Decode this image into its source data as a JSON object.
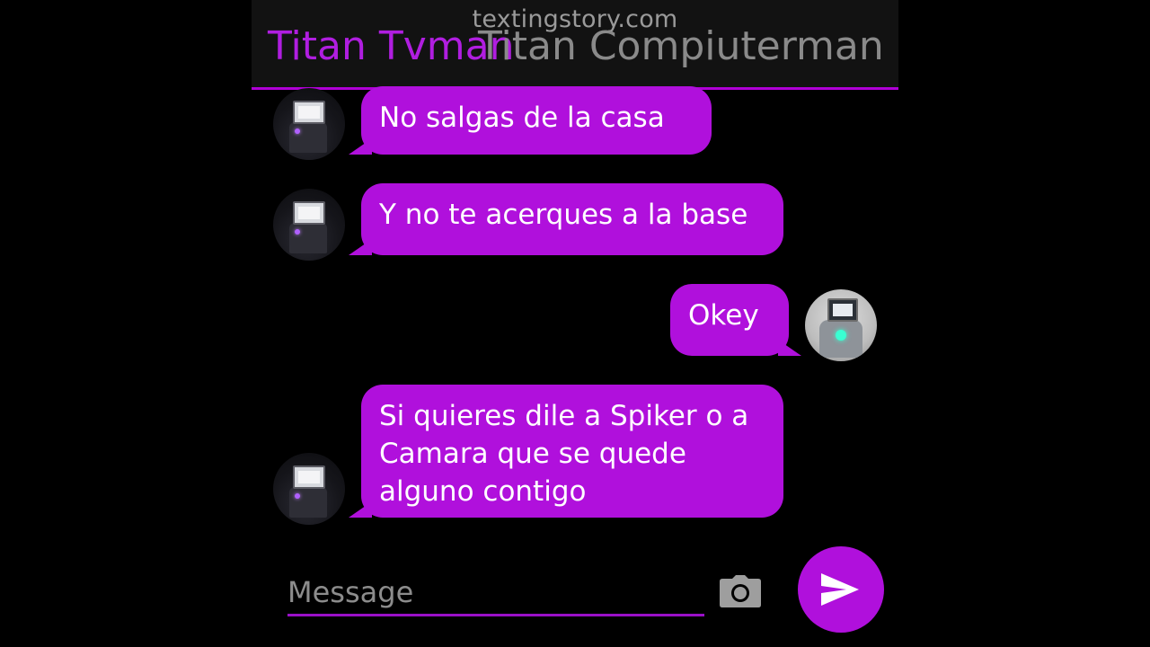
{
  "watermark": "textingstory.com",
  "header": {
    "contact_name": "Titan Tvman",
    "contact_name_overlay": "Titan Compiuterman"
  },
  "messages": [
    {
      "sender": "received",
      "text": "No salgas de la casa"
    },
    {
      "sender": "received",
      "text": "Y no te acerques a la base"
    },
    {
      "sender": "sent",
      "text": "Okey"
    },
    {
      "sender": "received",
      "text": "Si quieres dile a Spiker o a Camara que se quede alguno contigo"
    }
  ],
  "composer": {
    "placeholder": "Message",
    "camera_icon": "camera-icon",
    "send_icon": "send-icon"
  },
  "colors": {
    "accent": "#b010dc",
    "header_bg": "#121212",
    "background": "#000000",
    "placeholder": "#8c8c8c",
    "camera": "#9e9e9e"
  }
}
